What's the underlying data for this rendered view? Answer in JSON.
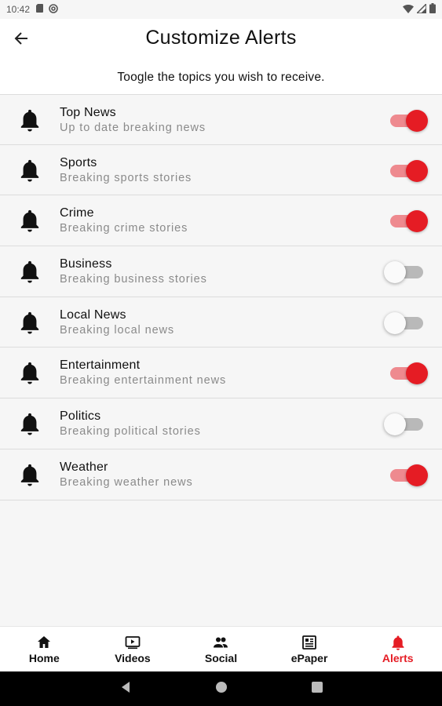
{
  "status_bar": {
    "time": "10:42",
    "left_icons": [
      "sd-card-icon",
      "at-sign-icon"
    ],
    "right_icons": [
      "wifi-icon",
      "signal-icon",
      "battery-icon"
    ]
  },
  "header": {
    "title": "Customize Alerts",
    "subtitle": "Toogle the topics you wish to receive.",
    "back_icon": "back-arrow-icon"
  },
  "colors": {
    "accent": "#e51c24",
    "track_on": "#ee8a8f",
    "track_off": "#b9b9b9",
    "background": "#f6f6f6"
  },
  "topics": [
    {
      "name": "Top News",
      "description": "Up to date breaking news",
      "enabled": true
    },
    {
      "name": "Sports",
      "description": "Breaking sports stories",
      "enabled": true
    },
    {
      "name": "Crime",
      "description": "Breaking crime stories",
      "enabled": true
    },
    {
      "name": "Business",
      "description": "Breaking business stories",
      "enabled": false
    },
    {
      "name": "Local News",
      "description": "Breaking local news",
      "enabled": false
    },
    {
      "name": "Entertainment",
      "description": "Breaking entertainment news",
      "enabled": true
    },
    {
      "name": "Politics",
      "description": "Breaking political stories",
      "enabled": false
    },
    {
      "name": "Weather",
      "description": "Breaking weather news",
      "enabled": true
    }
  ],
  "bottom_nav": [
    {
      "label": "Home",
      "icon": "home-icon",
      "active": false
    },
    {
      "label": "Videos",
      "icon": "video-icon",
      "active": false
    },
    {
      "label": "Social",
      "icon": "people-icon",
      "active": false
    },
    {
      "label": "ePaper",
      "icon": "newspaper-icon",
      "active": false
    },
    {
      "label": "Alerts",
      "icon": "bell-icon",
      "active": true
    }
  ],
  "system_nav": [
    "back-triangle-icon",
    "home-circle-icon",
    "recents-square-icon"
  ]
}
